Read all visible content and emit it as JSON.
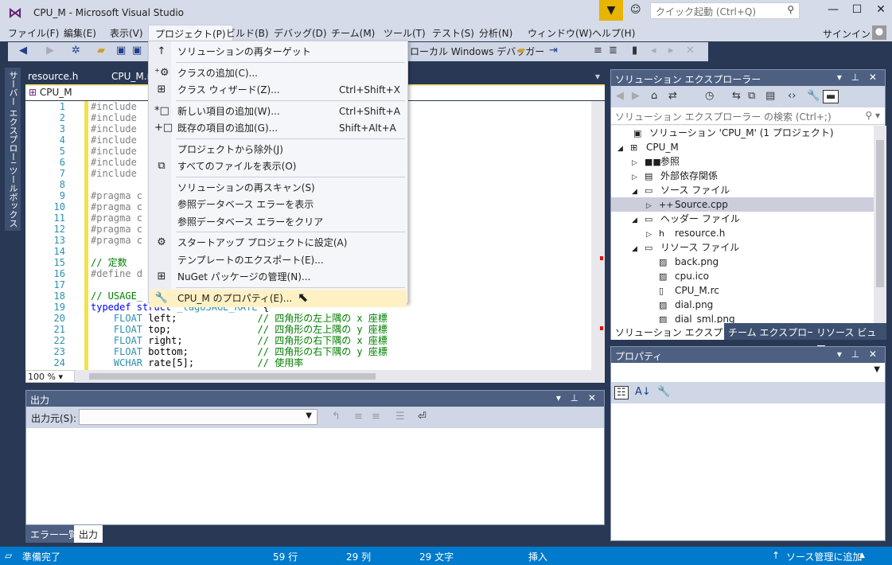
{
  "window": {
    "title": "CPU_M - Microsoft Visual Studio",
    "quick_launch_placeholder": "クイック起動 (Ctrl+Q)",
    "sign_in": "サインイン"
  },
  "menubar": [
    "ファイル(F)",
    "編集(E)",
    "表示(V)",
    "プロジェクト(P)",
    "ビルド(B)",
    "デバッグ(D)",
    "チーム(M)",
    "ツール(T)",
    "テスト(S)",
    "分析(N)",
    "ウィンドウ(W)",
    "ヘルプ(H)"
  ],
  "toolbar": {
    "debugger": "ローカル Windows デバッガー"
  },
  "left_dock": {
    "server_explorer": "サーバー エクスプローラー",
    "toolbox": "ツールボックス"
  },
  "editor": {
    "tabs": [
      "resource.h",
      "CPU_M.rc"
    ],
    "nav_project": "CPU_M",
    "zoom": "100 %",
    "lines": [
      [
        [
          "pp",
          "#include"
        ]
      ],
      [
        [
          "pp",
          "#include"
        ]
      ],
      [
        [
          "pp",
          "#include"
        ]
      ],
      [
        [
          "pp",
          "#include"
        ]
      ],
      [
        [
          "pp",
          "#include"
        ]
      ],
      [
        [
          "pp",
          "#include"
        ]
      ],
      [
        [
          "pp",
          "#include"
        ]
      ],
      [],
      [
        [
          "pp",
          "#pragma c"
        ]
      ],
      [
        [
          "pp",
          "#pragma c"
        ]
      ],
      [
        [
          "pp",
          "#pragma c"
        ]
      ],
      [
        [
          "pp",
          "#pragma c"
        ]
      ],
      [
        [
          "pp",
          "#pragma c"
        ]
      ],
      [],
      [
        [
          "cm",
          "// 定数"
        ]
      ],
      [
        [
          "pp",
          "#define d"
        ]
      ],
      [],
      [
        [
          "cm",
          "// USAGE_"
        ]
      ],
      [
        [
          "kw",
          "typedef struct "
        ],
        [
          "ty",
          "_tagUSAGE_RATE"
        ],
        [
          "tx",
          " {"
        ]
      ],
      [
        [
          "ty",
          "    FLOAT"
        ],
        [
          "tx",
          " left;              "
        ],
        [
          "cm",
          "// 四角形の左上隅の x 座標"
        ]
      ],
      [
        [
          "ty",
          "    FLOAT"
        ],
        [
          "tx",
          " top;               "
        ],
        [
          "cm",
          "// 四角形の左上隅の y 座標"
        ]
      ],
      [
        [
          "ty",
          "    FLOAT"
        ],
        [
          "tx",
          " right;             "
        ],
        [
          "cm",
          "// 四角形の右下隅の x 座標"
        ]
      ],
      [
        [
          "ty",
          "    FLOAT"
        ],
        [
          "tx",
          " bottom;            "
        ],
        [
          "cm",
          "// 四角形の右下隅の y 座標"
        ]
      ],
      [
        [
          "ty",
          "    WCHAR"
        ],
        [
          "tx",
          " rate[5];           "
        ],
        [
          "cm",
          "// 使用率"
        ]
      ]
    ]
  },
  "project_menu": [
    {
      "icon": "↑",
      "label": "ソリューションの再ターゲット",
      "shortcut": ""
    },
    {
      "sep": true
    },
    {
      "icon": "⁺⚙",
      "label": "クラスの追加(C)...",
      "shortcut": ""
    },
    {
      "icon": "⊞",
      "label": "クラス ウィザード(Z)...",
      "shortcut": "Ctrl+Shift+X"
    },
    {
      "sep": true
    },
    {
      "icon": "*□",
      "label": "新しい項目の追加(W)...",
      "shortcut": "Ctrl+Shift+A"
    },
    {
      "icon": "+□",
      "label": "既存の項目の追加(G)...",
      "shortcut": "Shift+Alt+A"
    },
    {
      "sep": true
    },
    {
      "icon": "",
      "label": "プロジェクトから除外(J)",
      "shortcut": ""
    },
    {
      "icon": "⧉",
      "label": "すべてのファイルを表示(O)",
      "shortcut": ""
    },
    {
      "sep": true
    },
    {
      "icon": "",
      "label": "ソリューションの再スキャン(S)",
      "shortcut": ""
    },
    {
      "icon": "",
      "label": "参照データベース エラーを表示",
      "shortcut": ""
    },
    {
      "icon": "",
      "label": "参照データベース エラーをクリア",
      "shortcut": ""
    },
    {
      "sep": true
    },
    {
      "icon": "⚙",
      "label": "スタートアップ プロジェクトに設定(A)",
      "shortcut": ""
    },
    {
      "icon": "",
      "label": "テンプレートのエクスポート(E)...",
      "shortcut": ""
    },
    {
      "icon": "⊞",
      "label": "NuGet パッケージの管理(N)...",
      "shortcut": ""
    },
    {
      "sep": true
    },
    {
      "icon": "🔧",
      "label": "CPU_M のプロパティ(E)...",
      "shortcut": "",
      "highlighted": true
    }
  ],
  "output": {
    "title": "出力",
    "source_label": "出力元(S):",
    "source_value": "",
    "tabs": [
      "エラー一覧",
      "出力"
    ],
    "active_tab": "出力"
  },
  "solution_explorer": {
    "title": "ソリューション エクスプローラー",
    "search_placeholder": "ソリューション エクスプローラー の検索 (Ctrl+;)",
    "tree": [
      {
        "label": "ソリューション 'CPU_M' (1 プロジェクト)",
        "depth": 0,
        "arrow": "",
        "icon": "▣"
      },
      {
        "label": "CPU_M",
        "depth": 0,
        "arrow": "◢",
        "icon": "⊞"
      },
      {
        "label": "参照",
        "depth": 1,
        "arrow": "▷",
        "icon": "■■"
      },
      {
        "label": "外部依存関係",
        "depth": 1,
        "arrow": "▷",
        "icon": "▤"
      },
      {
        "label": "ソース ファイル",
        "depth": 1,
        "arrow": "◢",
        "icon": "▭"
      },
      {
        "label": "Source.cpp",
        "depth": 2,
        "arrow": "▷",
        "icon": "++",
        "selected": true
      },
      {
        "label": "ヘッダー ファイル",
        "depth": 1,
        "arrow": "◢",
        "icon": "▭"
      },
      {
        "label": "resource.h",
        "depth": 2,
        "arrow": "▷",
        "icon": "h"
      },
      {
        "label": "リソース ファイル",
        "depth": 1,
        "arrow": "◢",
        "icon": "▭"
      },
      {
        "label": "back.png",
        "depth": 2,
        "arrow": "",
        "icon": "▨"
      },
      {
        "label": "cpu.ico",
        "depth": 2,
        "arrow": "",
        "icon": "▨"
      },
      {
        "label": "CPU_M.rc",
        "depth": 2,
        "arrow": "",
        "icon": "▯"
      },
      {
        "label": "dial.png",
        "depth": 2,
        "arrow": "",
        "icon": "▨"
      },
      {
        "label": "dial_sml.png",
        "depth": 2,
        "arrow": "",
        "icon": "▨"
      }
    ],
    "tabs": [
      "ソリューション エクスプローラー",
      "チーム エクスプローラー",
      "リソース ビュー"
    ]
  },
  "properties": {
    "title": "プロパティ"
  },
  "status": {
    "ready": "準備完了",
    "line": "59 行",
    "col": "29 列",
    "chars": "29 文字",
    "mode": "挿入",
    "source_control": "ソース管理に追加"
  },
  "colors": {
    "accent": "#007acc",
    "dock_bg": "#293955",
    "menu_highlight": "#fff1c4"
  }
}
